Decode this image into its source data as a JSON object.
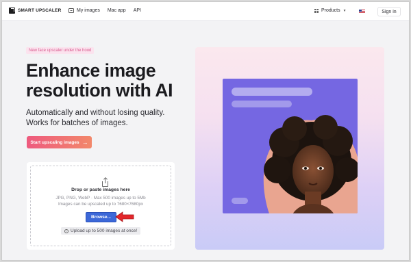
{
  "header": {
    "logo_text": "SMART UPSCALER",
    "nav": [
      {
        "label": "My images",
        "icon": "image-icon"
      },
      {
        "label": "Mac app"
      },
      {
        "label": "API"
      }
    ],
    "products_label": "Products",
    "language_icon": "us-flag-icon",
    "signin_label": "Sign in"
  },
  "hero": {
    "badge": "New face upscaler under the hood",
    "headline_line1": "Enhance image",
    "headline_line2": "resolution with AI",
    "sub_line1": "Automatically and without losing quality.",
    "sub_line2": "Works for batches of images.",
    "cta_label": "Start upscaling images",
    "cta_arrow": "→"
  },
  "upload": {
    "title": "Drop or paste images here",
    "info_line1": "JPG, PNG, WebP · Max 500 images up to 5Mb",
    "info_line2": "Images can be upscaled up to 7680×7680px",
    "browse_label": "Browse...",
    "hint": "Upload up to 500 images at once!"
  },
  "colors": {
    "accent_pink": "#ee5a7e",
    "browse_blue": "#3c68d8",
    "visual_purple": "#7567e2",
    "annotation_red": "#e3262a"
  }
}
